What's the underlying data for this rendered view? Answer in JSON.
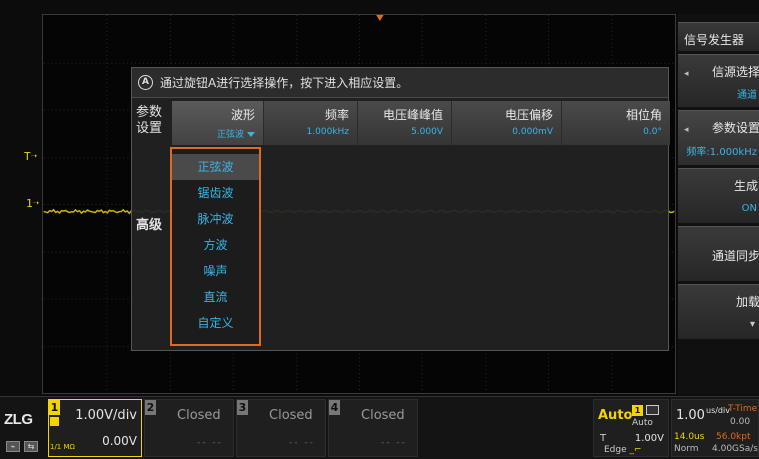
{
  "markers": {
    "trigger_level": "T",
    "channel1": "1"
  },
  "right_panel": {
    "title": "信号发生器",
    "items": [
      {
        "title": "信源选择",
        "value": "通道"
      },
      {
        "title": "参数设置",
        "value": "频率:1.000kHz"
      },
      {
        "title": "生成",
        "value": "ON"
      },
      {
        "title": "通道同步",
        "value": ""
      },
      {
        "title": "加载",
        "value": ""
      }
    ]
  },
  "dialog": {
    "hint": "通过旋钮A进行选择操作，按下进入相应设置。",
    "knob_label": "A",
    "row_labels": {
      "params": "参数设置",
      "advanced": "高级"
    },
    "params": [
      {
        "label": "波形",
        "value": "正弦波"
      },
      {
        "label": "频率",
        "value": "1.000kHz"
      },
      {
        "label": "电压峰峰值",
        "value": "5.000V"
      },
      {
        "label": "电压偏移",
        "value": "0.000mV"
      },
      {
        "label": "相位角",
        "value": "0.0°"
      }
    ],
    "waveform_options": [
      "正弦波",
      "锯齿波",
      "脉冲波",
      "方波",
      "噪声",
      "直流",
      "自定义"
    ],
    "selected_option": 0
  },
  "bottom": {
    "logo": "ZLG",
    "ch1": {
      "num": "1",
      "scale": "1.00V/div",
      "offset": "0.00V",
      "impedance": "1/1 MΩ"
    },
    "ch2": {
      "num": "2",
      "state": "Closed",
      "dashes": "-- --"
    },
    "ch3": {
      "num": "3",
      "state": "Closed",
      "dashes": "-- --"
    },
    "ch4": {
      "num": "4",
      "state": "Closed",
      "dashes": "-- --"
    },
    "trigger": {
      "mode": "Auto",
      "mode_small": "Auto",
      "ch": "1",
      "type": "T",
      "level": "1.00V",
      "slope": "Edge"
    },
    "timebase": {
      "scale": "1.00",
      "unit": "us/div",
      "mode": "T-Time",
      "delay": "0.00",
      "position": "14.0us",
      "sample_rate": "56.0kpt",
      "acquire": "Norm",
      "sample": "4.00GSa/s"
    }
  },
  "colors": {
    "ch1": "#f1d400",
    "accent": "#e06a1e",
    "value_blue": "#38b4e8"
  }
}
